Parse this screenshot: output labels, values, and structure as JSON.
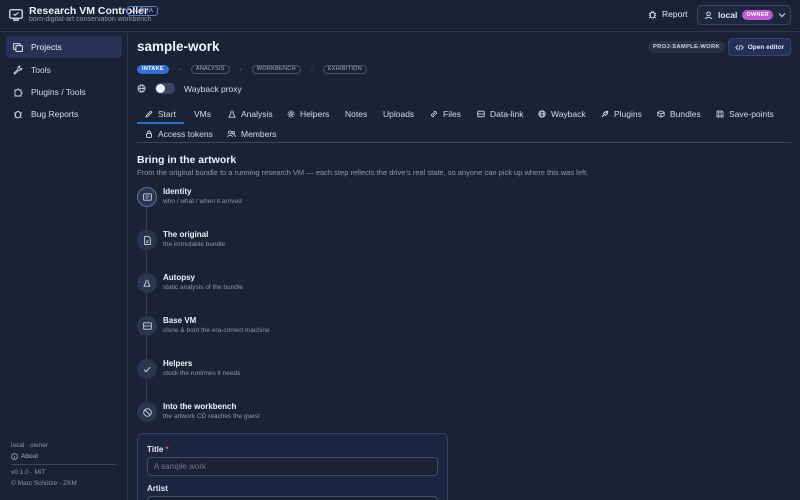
{
  "app": {
    "title": "Research VM Controller",
    "badge": "ALPHA",
    "subtitle": "born-digital-art conservation workbench"
  },
  "header": {
    "report_label": "Report",
    "user": "local",
    "role_badge": "OWNER"
  },
  "sidebar": {
    "items": [
      {
        "label": "Projects",
        "icon": "folder-icon",
        "active": true
      },
      {
        "label": "Tools",
        "icon": "wrench-icon"
      },
      {
        "label": "Plugins / Tools",
        "icon": "puzzle-icon"
      },
      {
        "label": "Bug Reports",
        "icon": "bug-icon"
      }
    ],
    "footer": {
      "user_role": "local · owner",
      "about_label": "About",
      "version": "v0.1.0 · MIT",
      "copyright": "© Marc Schütze · ZKM"
    }
  },
  "project": {
    "title": "sample-work",
    "id_badge": "PROJ-SAMPLE-WORK",
    "open_editor_label": "Open editor",
    "stages": [
      "INTAKE",
      "ANALYSIS",
      "WORKBENCH",
      "EXHIBITION"
    ],
    "active_stage": "INTAKE",
    "wayback_label": "Wayback proxy",
    "wayback_enabled": false
  },
  "tabs": [
    {
      "label": "Start",
      "icon": "pencil-icon",
      "active": true
    },
    {
      "label": "VMs",
      "icon": ""
    },
    {
      "label": "Analysis",
      "icon": "flask-icon"
    },
    {
      "label": "Helpers",
      "icon": "gear-icon"
    },
    {
      "label": "Notes",
      "icon": ""
    },
    {
      "label": "Uploads",
      "icon": ""
    },
    {
      "label": "Files",
      "icon": "link-icon"
    },
    {
      "label": "Data-link",
      "icon": "drive-icon"
    },
    {
      "label": "Wayback",
      "icon": "globe-icon"
    },
    {
      "label": "Plugins",
      "icon": "plug-icon"
    },
    {
      "label": "Bundles",
      "icon": "package-icon"
    },
    {
      "label": "Save-points",
      "icon": "save-icon"
    },
    {
      "label": "Access tokens",
      "icon": "lock-icon"
    },
    {
      "label": "Members",
      "icon": "users-icon"
    }
  ],
  "section": {
    "title": "Bring in the artwork",
    "description": "From the original bundle to a running research VM — each step reflects the drive's real state, so anyone can pick up where this was left."
  },
  "steps": [
    {
      "title": "Identity",
      "subtitle": "who / what / when it arrived",
      "icon": "id-card-icon"
    },
    {
      "title": "The original",
      "subtitle": "the immutable bundle",
      "icon": "file-icon"
    },
    {
      "title": "Autopsy",
      "subtitle": "static analysis of the bundle",
      "icon": "flask-icon"
    },
    {
      "title": "Base VM",
      "subtitle": "clone & boot the era-correct machine",
      "icon": "server-icon"
    },
    {
      "title": "Helpers",
      "subtitle": "stock the runtimes it needs",
      "icon": "check-icon"
    },
    {
      "title": "Into the workbench",
      "subtitle": "the artwork CD reaches the guest",
      "icon": "disc-icon"
    }
  ],
  "form": {
    "title_label": "Title",
    "title_required_mark": "*",
    "title_placeholder": "A sample work",
    "artist_label": "Artist"
  },
  "colors": {
    "background": "#1a2236",
    "accent": "#2f6fd6",
    "owner_badge": "#c05ad6",
    "required": "#e55a5a"
  }
}
